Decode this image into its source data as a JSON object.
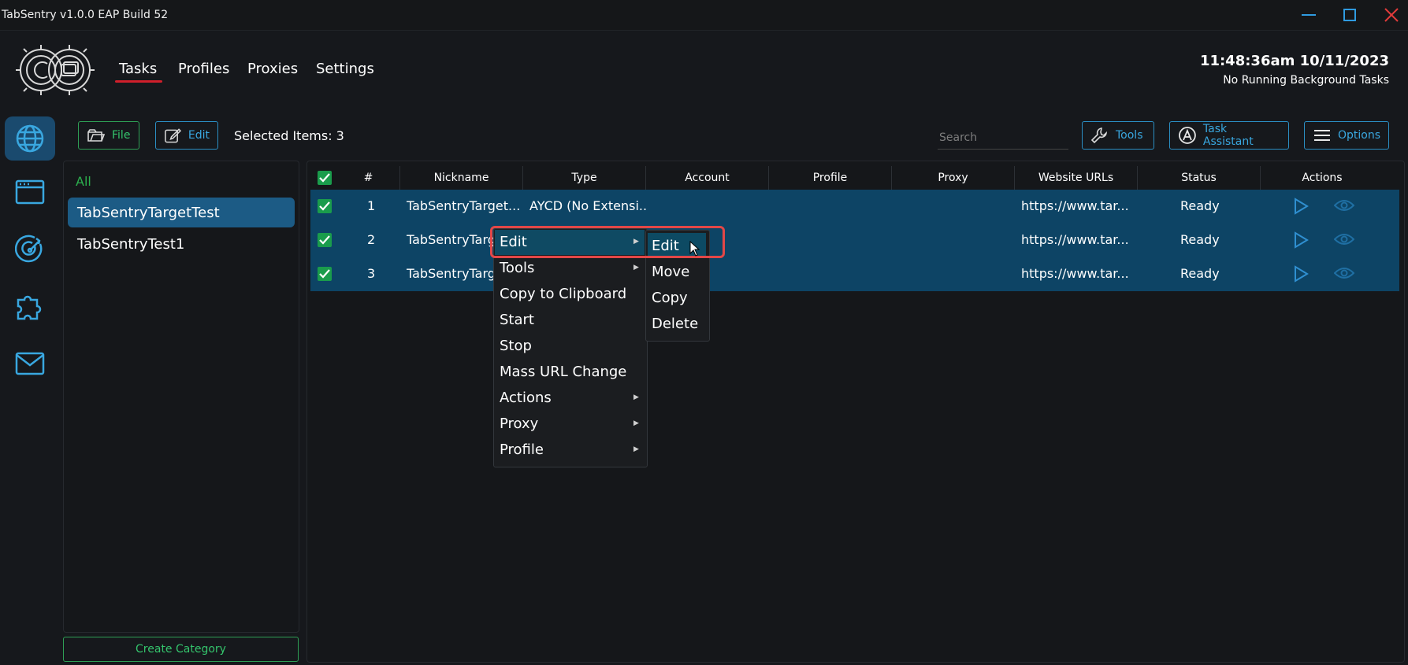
{
  "window": {
    "title": "TabSentry v1.0.0 EAP Build 52"
  },
  "nav": {
    "tabs": [
      "Tasks",
      "Profiles",
      "Proxies",
      "Settings"
    ],
    "active": "Tasks"
  },
  "header": {
    "clock": "11:48:36am 10/11/2023",
    "background_status": "No Running Background Tasks"
  },
  "sidebar": {
    "icons": [
      "globe-icon",
      "browser-window-icon",
      "target-icon",
      "puzzle-icon",
      "mail-icon"
    ]
  },
  "toolbar": {
    "file_label": "File",
    "edit_label": "Edit",
    "selected_items": "Selected Items: 3",
    "search_placeholder": "Search",
    "tools_label": "Tools",
    "task_assistant_label": "Task Assistant",
    "options_label": "Options"
  },
  "categories": {
    "all_label": "All",
    "items": [
      "TabSentryTargetTest",
      "TabSentryTest1"
    ],
    "create_label": "Create Category"
  },
  "table": {
    "columns": [
      "#",
      "Nickname",
      "Type",
      "Account",
      "Profile",
      "Proxy",
      "Website URLs",
      "Status",
      "Actions"
    ],
    "rows": [
      {
        "num": "1",
        "nickname": "TabSentryTarget...",
        "type": "AYCD (No Extensi...",
        "account": "",
        "profile": "",
        "proxy": "",
        "url": "https://www.tar...",
        "status": "Ready"
      },
      {
        "num": "2",
        "nickname": "TabSentryTarg",
        "type": "",
        "account": "",
        "profile": "",
        "proxy": "",
        "url": "https://www.tar...",
        "status": "Ready"
      },
      {
        "num": "3",
        "nickname": "TabSentryTarg",
        "type": "",
        "account": "",
        "profile": "",
        "proxy": "",
        "url": "https://www.tar...",
        "status": "Ready"
      }
    ]
  },
  "context_menu": {
    "items": [
      "Edit",
      "Tools",
      "Copy to Clipboard",
      "Start",
      "Stop",
      "Mass URL Change",
      "Actions",
      "Proxy",
      "Profile"
    ],
    "submenu_items": [
      "Edit",
      "Move",
      "Copy",
      "Delete"
    ]
  },
  "colors": {
    "accent_blue": "#1c5b85",
    "row_selected": "#0d4465",
    "accent_green": "#2cb04e",
    "accent_red": "#d11f2b",
    "highlight_box": "#e34747"
  }
}
